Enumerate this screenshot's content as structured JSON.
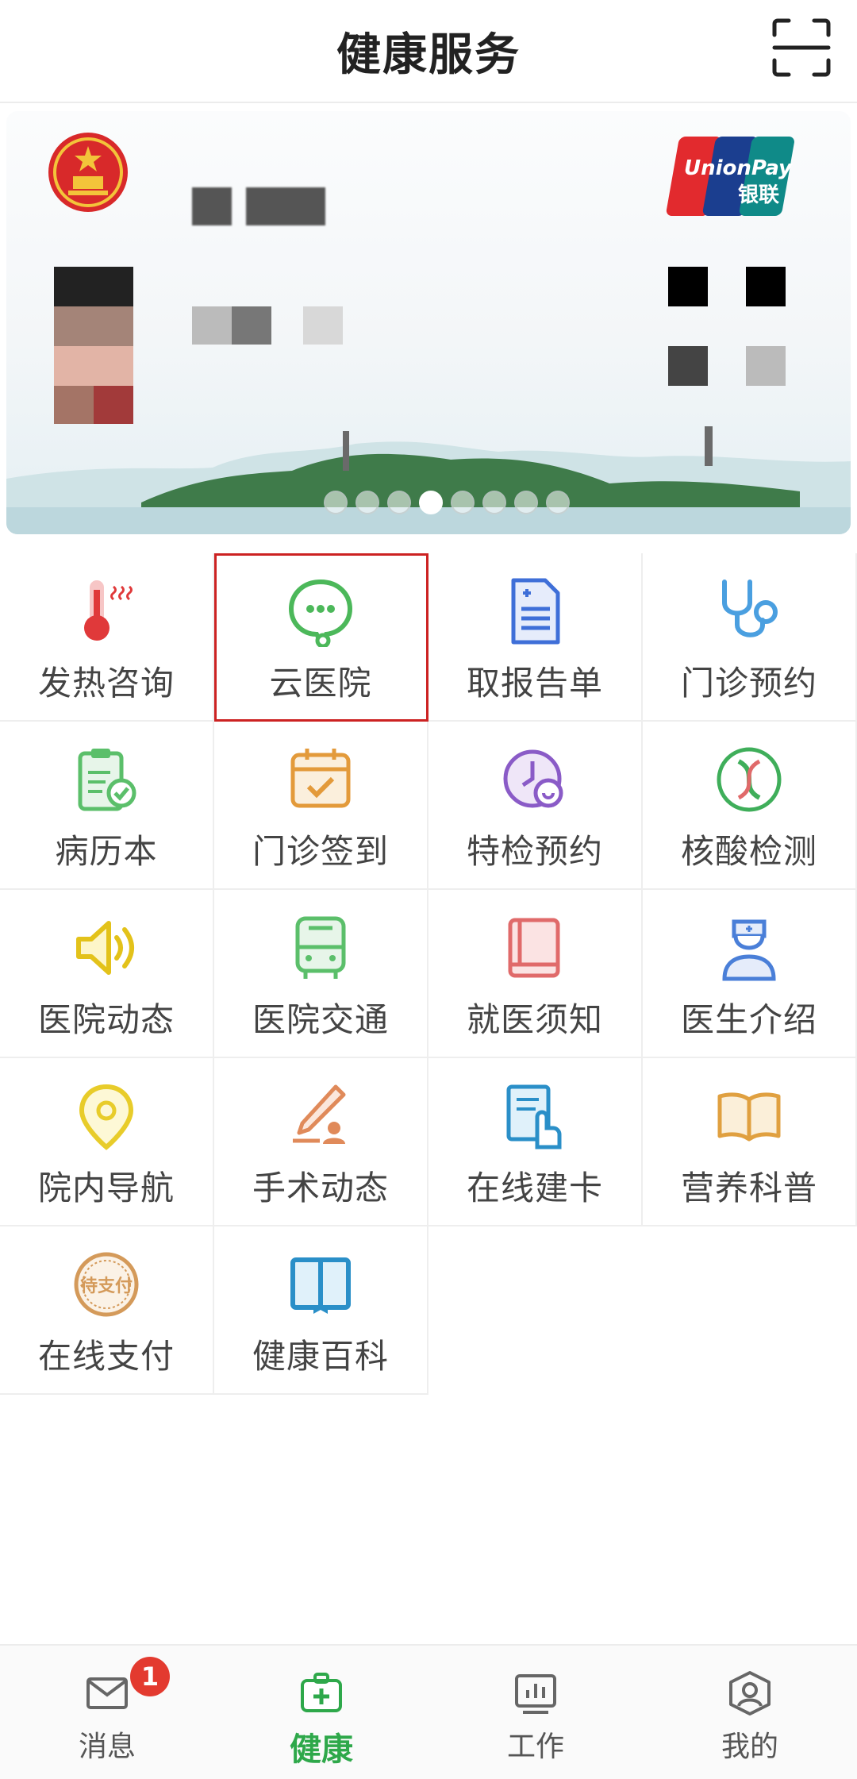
{
  "header": {
    "title": "健康服务",
    "scan_icon": "scan-icon"
  },
  "card": {
    "emblem_icon": "national-emblem-icon",
    "brand_logo": {
      "line1": "UnionPay",
      "line2": "银联"
    },
    "pager": {
      "total": 8,
      "active_index": 3
    }
  },
  "services": [
    {
      "label": "发热咨询",
      "icon": "thermometer-icon",
      "color": "#e0393a",
      "highlighted": false
    },
    {
      "label": "云医院",
      "icon": "chat-bubble-icon",
      "color": "#4cb85a",
      "highlighted": true
    },
    {
      "label": "取报告单",
      "icon": "report-document-icon",
      "color": "#3f6fd8",
      "highlighted": false
    },
    {
      "label": "门诊预约",
      "icon": "stethoscope-icon",
      "color": "#4a9fe0",
      "highlighted": false
    },
    {
      "label": "病历本",
      "icon": "medical-record-icon",
      "color": "#5bbf6a",
      "highlighted": false
    },
    {
      "label": "门诊签到",
      "icon": "calendar-check-icon",
      "color": "#e39a3a",
      "highlighted": false
    },
    {
      "label": "特检预约",
      "icon": "clock-exam-icon",
      "color": "#8a5bc7",
      "highlighted": false
    },
    {
      "label": "核酸检测",
      "icon": "dna-icon",
      "color": "#3fae5a",
      "highlighted": false
    },
    {
      "label": "医院动态",
      "icon": "speaker-icon",
      "color": "#e3c21a",
      "highlighted": false
    },
    {
      "label": "医院交通",
      "icon": "bus-icon",
      "color": "#5bbf6a",
      "highlighted": false
    },
    {
      "label": "就医须知",
      "icon": "book-notice-icon",
      "color": "#e06a6a",
      "highlighted": false
    },
    {
      "label": "医生介绍",
      "icon": "doctor-icon",
      "color": "#4a7fd8",
      "highlighted": false
    },
    {
      "label": "院内导航",
      "icon": "location-pin-icon",
      "color": "#e8cc2a",
      "highlighted": false
    },
    {
      "label": "手术动态",
      "icon": "scalpel-icon",
      "color": "#e08a5a",
      "highlighted": false
    },
    {
      "label": "在线建卡",
      "icon": "card-hand-icon",
      "color": "#2a8fc8",
      "highlighted": false
    },
    {
      "label": "营养科普",
      "icon": "open-book-icon",
      "color": "#e0a040",
      "highlighted": false
    },
    {
      "label": "在线支付",
      "icon": "pay-stamp-icon",
      "color": "#d49a5a",
      "highlighted": false,
      "stamp_text": "待支付"
    },
    {
      "label": "健康百科",
      "icon": "encyclopedia-icon",
      "color": "#2a8fc8",
      "highlighted": false
    }
  ],
  "bottom_nav": [
    {
      "label": "消息",
      "icon": "mail-icon",
      "active": false,
      "badge": "1"
    },
    {
      "label": "健康",
      "icon": "health-kit-icon",
      "active": true
    },
    {
      "label": "工作",
      "icon": "chart-board-icon",
      "active": false
    },
    {
      "label": "我的",
      "icon": "profile-icon",
      "active": false
    }
  ],
  "colors": {
    "accent": "#2ea84a",
    "highlight_border": "#cc2222",
    "badge": "#e33a2f"
  }
}
